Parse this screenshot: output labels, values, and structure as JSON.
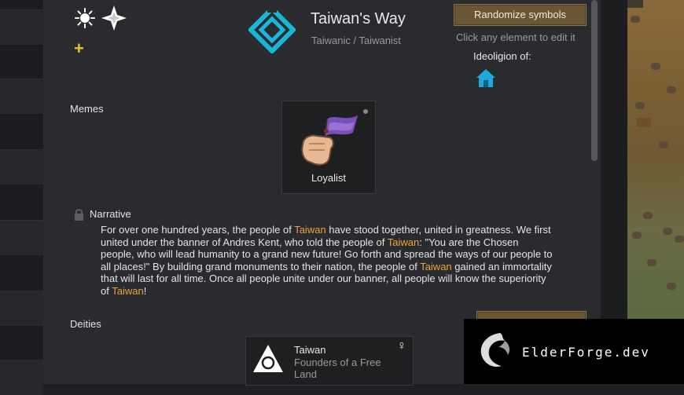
{
  "ideoligion": {
    "name": "Taiwan's Way",
    "adjective_line": "Taiwanic / Taiwanist"
  },
  "header": {
    "randomize_button": "Randomize symbols",
    "edit_hint": "Click any element to edit it",
    "ideoligion_of_label": "Ideoligion of:"
  },
  "memes": {
    "label": "Memes",
    "items": [
      {
        "name": "Loyalist",
        "icon": "raised-fist-flag-icon"
      }
    ]
  },
  "narrative": {
    "label": "Narrative",
    "highlight": "Taiwan",
    "parts": [
      "For over one hundred years, the people of ",
      " have stood together, united in greatness. We first united under the banner of Andres Kent, who told the people of ",
      ": \"You are the Chosen people, who will lead humanity to a grand new future! Go forth and spread the ways of our people to all places!\" By building grand monuments to their nation, the people of ",
      " gained an immortality that will last for all time. Once all people unite under our banner, all people will know the superiority of ",
      "!"
    ]
  },
  "deities": {
    "label": "Deities",
    "items": [
      {
        "name": "Taiwan",
        "title": "Founders of a Free Land",
        "gender_symbol": "♀"
      }
    ]
  },
  "watermark": {
    "text": "ElderForge.dev"
  },
  "colors": {
    "accent_orange": "#e8a33c",
    "button_brown": "#6b5634",
    "emblem_cyan": "#1ab6d8"
  }
}
